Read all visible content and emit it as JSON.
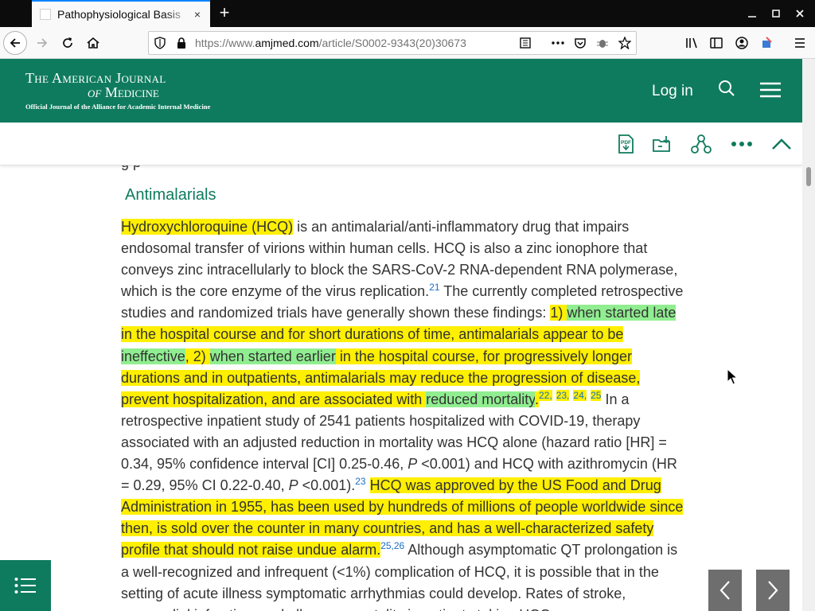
{
  "browser": {
    "tab_title": "Pathophysiological Basis",
    "url_prefix": "https://www.",
    "url_domain": "amjmed.com",
    "url_rest": "/article/S0002-9343(20)30673",
    "new_tab_label": "+",
    "tab_close_label": "×"
  },
  "site": {
    "logo_line1": "The American Journal",
    "logo_of": "of",
    "logo_line2": "Medicine",
    "logo_line3": "Official Journal of the Alliance for Academic Internal Medicine",
    "login_label": "Log in"
  },
  "article": {
    "cut_text": "g      p",
    "section_title": "Antimalarials",
    "p": {
      "s1": "Hydroxychloroquine (HCQ)",
      "s2": " is an antimalarial/anti-inflammatory drug that impairs endosomal transfer of virions within human cells. HCQ is also a zinc ionophore that conveys zinc intracellularly to block the SARS-CoV-2 RNA-dependent RNA polymerase, which is the core enzyme of the virus replication.",
      "r21": "21",
      "s3": " The currently completed retrospective studies and randomized trials have generally shown these findings: ",
      "s4": "1) ",
      "s5": "when started late",
      "s6": " in the hospital course and for short durations of time, antimalarials appear to be ",
      "s7": "ineffective",
      "s8": ", 2) ",
      "s9": "when started earlier",
      "s10": " in the hospital course, for progressively longer durations and in outpatients, antimalarials may reduce the progression of disease, prevent hospitalization, and are associated with ",
      "s11": "reduced mortality",
      "s12": ".",
      "r22": "22,",
      "r23": "23,",
      "r24": "24,",
      "r25": "25",
      "s13": " In a retrospective inpatient study of 2541 patients hospitalized with COVID-19, therapy associated with an adjusted reduction in mortality was HCQ alone (hazard ratio [HR] = 0.34, 95% confidence interval [CI] 0.25-0.46, ",
      "p1": "P",
      "s14": " <0.001) and HCQ with azithromycin (HR = 0.29, 95% CI 0.22-0.40, ",
      "p2": "P",
      "s15": " <0.001).",
      "r23b": "23",
      "s16": " ",
      "s17": "HCQ was approved by the US Food and Drug Administration in 1955, has been used by hundreds of millions of people worldwide since then, is sold over the counter in many countries, and has a well-characterized safety profile that should not raise undue alarm.",
      "r2526": "25,26",
      "s18": " Although asymptomatic QT prolongation is a well-recognized and infrequent (<1%) complication of HCQ, it is possible that in the setting of acute illness symptomatic arrhythmias could develop. Rates of stroke, myocardial infarction, and all-cause mortality in patients taking HCQ"
    }
  },
  "colors": {
    "brand_green": "#0f7b5e",
    "highlight_yellow": "#ffef00",
    "highlight_green": "#90ee90",
    "reference_blue": "#1a6fc4"
  }
}
